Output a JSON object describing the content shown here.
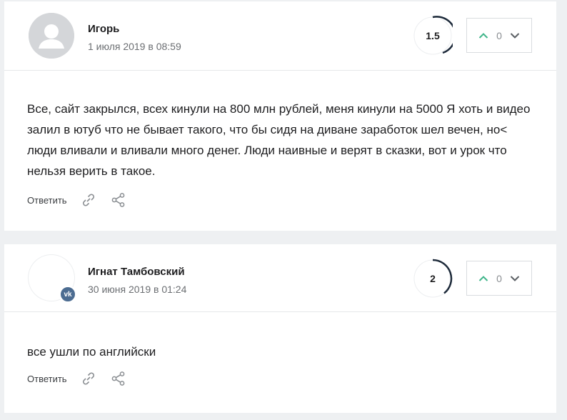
{
  "comments": [
    {
      "author": "Игорь",
      "date": "1 июля 2019 в 08:59",
      "rating": "1.5",
      "votes": "0",
      "text": "Все, сайт закрылся, всех кинули на 800 млн рублей, меня кинули на 5000 Я хоть и видео залил в ютуб что не бывает такого, что бы сидя на диване заработок шел вечен, но< люди вливали и вливали много денег. Люди наивные и верят в сказки, вот и урок что нельзя верить в такое.",
      "reply_label": "Ответить",
      "avatar": "default-user-avatar"
    },
    {
      "author": "Игнат Тамбовский",
      "date": "30 июня 2019 в 01:24",
      "rating": "2",
      "votes": "0",
      "text": "все ушли по английски",
      "reply_label": "Ответить",
      "avatar": "vk-user-avatar"
    }
  ],
  "colors": {
    "rating_arc": "#1d2a3a",
    "vote_up": "#3fb58a",
    "vote_down": "#5a5e63",
    "vk_badge": "#4c6c91"
  }
}
